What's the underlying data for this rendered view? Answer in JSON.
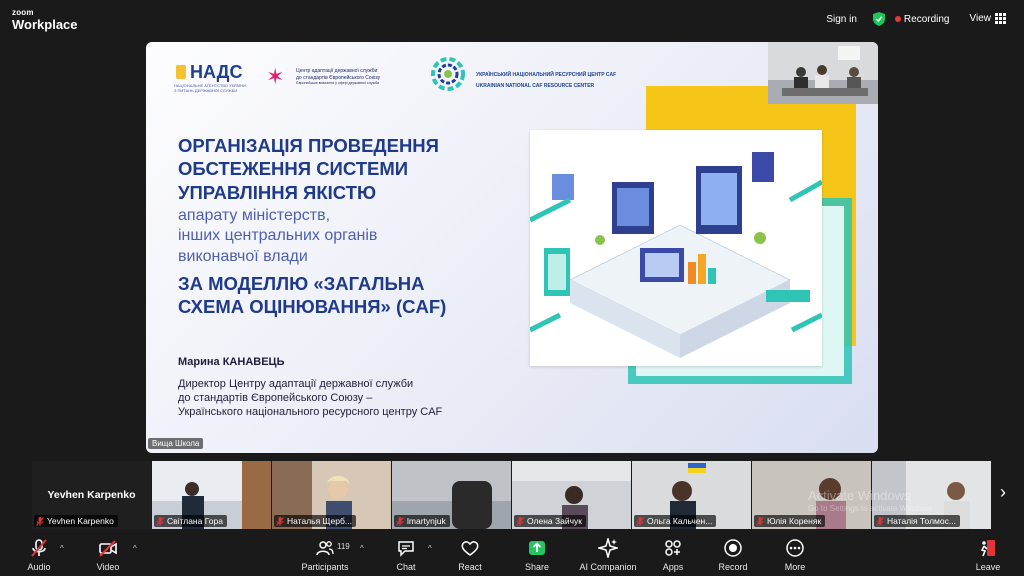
{
  "app": {
    "brand_line1": "zoom",
    "brand_line2": "Workplace"
  },
  "topbar": {
    "sign_in": "Sign in",
    "recording": "Recording",
    "view": "View",
    "colors": {
      "recording_dot": "#e53935",
      "secure": "#21c45a"
    }
  },
  "share": {
    "header": {
      "nads": "НАДС",
      "nads_sub": "НАЦІОНАЛЬНЕ АГЕНТСТВО УКРАЇНИ З ПИТАНЬ ДЕРЖАВНОЇ СЛУЖБИ",
      "caa_line1": "Центр адаптації державної служби",
      "caa_line2": "до стандартів Європейського Союзу",
      "caa_line3": "Європейське визнання у сфері державної служби",
      "caf_line1": "УКРАЇНСЬКИЙ НАЦІОНАЛЬНИЙ РЕСУРСНИЙ ЦЕНТР CAF",
      "caf_line2": "UKRAINIAN NATIONAL CAF RESOURCE CENTER"
    },
    "title_lines": [
      "ОРГАНІЗАЦІЯ ПРОВЕДЕННЯ",
      "ОБСТЕЖЕННЯ СИСТЕМИ",
      "УПРАВЛІННЯ ЯКІСТЮ"
    ],
    "subtitle_lines": [
      "апарату міністерств,",
      "інших центральних органів",
      "виконавчої влади"
    ],
    "title2_lines": [
      "ЗА МОДЕЛЛЮ «ЗАГАЛЬНА",
      "СХЕМА ОЦІНЮВАННЯ» (CAF)"
    ],
    "author": "Марина КАНАВЕЦЬ",
    "role_lines": [
      "Директор Центру адаптації державної служби",
      "до стандартів Європейського Союзу –",
      "Українського національного ресурсного центру CAF"
    ],
    "tag": "Вища Школа",
    "colors": {
      "title": "#1f3a8a",
      "accent_yellow": "#f5c518",
      "accent_teal": "#2ec4b6"
    }
  },
  "participants": [
    {
      "name": "Yevhen Karpenko",
      "big": "Yevhen Karpenko"
    },
    {
      "name": "Світлана Гора"
    },
    {
      "name": "Наталья Щерб..."
    },
    {
      "name": "lmartynjuk"
    },
    {
      "name": "Олена Зайчук"
    },
    {
      "name": "Ольга Кальчен..."
    },
    {
      "name": "Юлія Кореняк"
    },
    {
      "name": "Наталія Толмос..."
    }
  ],
  "watermark": {
    "line1": "Activate Windows",
    "line2": "Go to Settings to activate Windows."
  },
  "toolbar": {
    "audio": "Audio",
    "video": "Video",
    "participants": "Participants",
    "participants_count": "119",
    "chat": "Chat",
    "react": "React",
    "share": "Share",
    "ai": "AI Companion",
    "apps": "Apps",
    "record": "Record",
    "more": "More",
    "leave": "Leave",
    "colors": {
      "share_green": "#23c461",
      "muted_red": "#e0353b"
    }
  }
}
